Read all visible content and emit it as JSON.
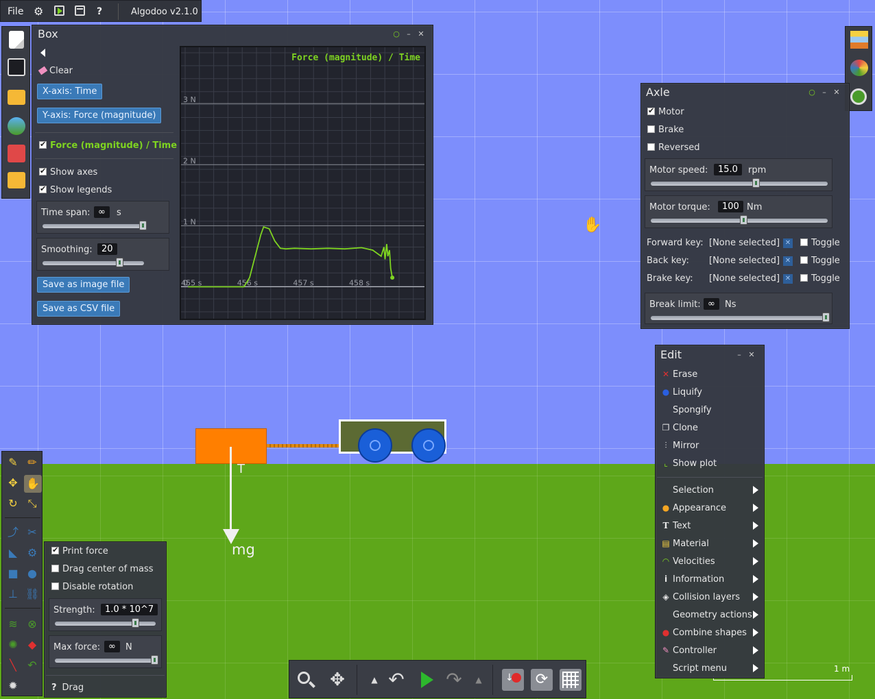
{
  "topbar": {
    "file": "File",
    "title": "Algodoo v2.1.0"
  },
  "box_panel": {
    "title": "Box",
    "clear": "Clear",
    "x_axis_btn": "X-axis: Time",
    "y_axis_btn": "Y-axis: Force (magnitude)",
    "series_label": "Force (magnitude) / Time",
    "show_axes": "Show axes",
    "show_legends": "Show legends",
    "time_span_label": "Time span:",
    "time_span_value": "∞",
    "time_span_unit": "s",
    "smoothing_label": "Smoothing:",
    "smoothing_value": "20",
    "save_image": "Save as image file",
    "save_csv": "Save as CSV file"
  },
  "chart_data": {
    "type": "line",
    "title": "Force (magnitude) / Time",
    "xlabel": "",
    "ylabel": "",
    "x_ticks": [
      "455 s",
      "456 s",
      "457 s",
      "458 s"
    ],
    "y_ticks": [
      "0",
      "1 N",
      "2 N",
      "3 N"
    ],
    "xlim": [
      454.9,
      459.2
    ],
    "ylim": [
      -0.5,
      3.9
    ],
    "series": [
      {
        "color": "#7ed321",
        "x": [
          455.0,
          455.5,
          456.0,
          456.1,
          456.2,
          456.3,
          456.35,
          456.45,
          456.55,
          456.65,
          456.75,
          456.9,
          457.2,
          457.5,
          457.8,
          458.1,
          458.3,
          458.45,
          458.5,
          458.52,
          458.55,
          458.57,
          458.6,
          458.62,
          458.65
        ],
        "y": [
          0.0,
          0.0,
          0.0,
          0.15,
          0.5,
          0.85,
          0.98,
          0.95,
          0.75,
          0.63,
          0.62,
          0.63,
          0.62,
          0.63,
          0.62,
          0.64,
          0.6,
          0.5,
          0.65,
          0.45,
          0.7,
          0.5,
          0.6,
          0.3,
          0.15
        ]
      }
    ],
    "grid": true
  },
  "axle_panel": {
    "title": "Axle",
    "motor": "Motor",
    "brake": "Brake",
    "reversed": "Reversed",
    "motor_speed_label": "Motor speed:",
    "motor_speed_value": "15.0",
    "motor_speed_unit": "rpm",
    "motor_torque_label": "Motor torque:",
    "motor_torque_value": "100",
    "motor_torque_unit": "Nm",
    "forward_key_label": "Forward key:",
    "back_key_label": "Back key:",
    "brake_key_label": "Brake key:",
    "none_selected": "[None selected]",
    "toggle": "Toggle",
    "break_limit_label": "Break limit:",
    "break_limit_value": "∞",
    "break_limit_unit": "Ns"
  },
  "edit_menu": {
    "title": "Edit",
    "items": [
      "Erase",
      "Liquify",
      "Spongify",
      "Clone",
      "Mirror",
      "Show plot"
    ],
    "submenus": [
      "Selection",
      "Appearance",
      "Text",
      "Material",
      "Velocities",
      "Information",
      "Collision layers",
      "Geometry actions",
      "Combine shapes",
      "Controller",
      "Script menu"
    ]
  },
  "drag_panel": {
    "print_force": "Print force",
    "drag_center": "Drag center of mass",
    "disable_rotation": "Disable rotation",
    "strength_label": "Strength:",
    "strength_value": "1.0 * 10^7",
    "max_force_label": "Max force:",
    "max_force_value": "∞",
    "max_force_unit": "N",
    "drag_label": "Drag"
  },
  "scene": {
    "force_label": "mg",
    "tension_label": "T",
    "scale_label": "1 m"
  }
}
